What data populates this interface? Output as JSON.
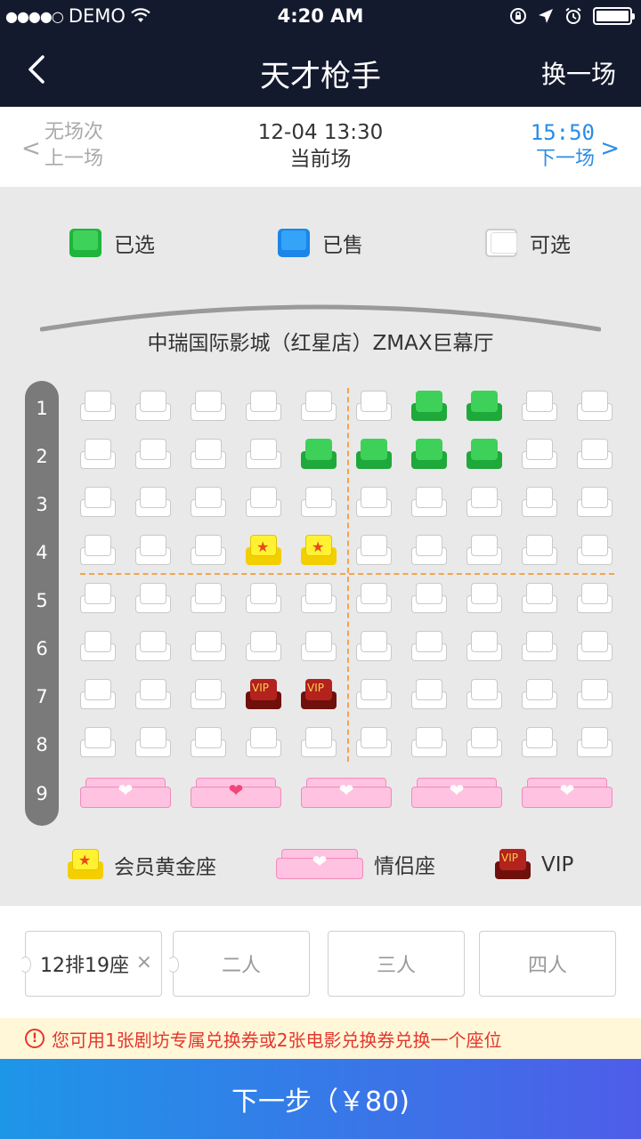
{
  "status": {
    "carrier": "DEMO",
    "time": "4:20 AM"
  },
  "nav": {
    "back_icon": "chevron-left-icon",
    "title": "天才枪手",
    "switch_label": "换一场"
  },
  "session": {
    "prev_line1": "无场次",
    "prev_line2": "上一场",
    "current_time": "12-04 13:30",
    "current_label": "当前场",
    "next_time": "15:50",
    "next_label": "下一场"
  },
  "legend": {
    "selected": "已选",
    "sold": "已售",
    "available": "可选"
  },
  "hall": {
    "name": "中瑞国际影城（红星店）ZMAX巨幕厅"
  },
  "rows": [
    "1",
    "2",
    "3",
    "4",
    "5",
    "6",
    "7",
    "8",
    "9"
  ],
  "seats": [
    [
      "white",
      "white",
      "white",
      "white",
      "white",
      "white",
      "green",
      "green",
      "white",
      "white"
    ],
    [
      "white",
      "white",
      "white",
      "white",
      "green",
      "green",
      "green",
      "green",
      "white",
      "white"
    ],
    [
      "white",
      "white",
      "white",
      "white",
      "white",
      "white",
      "white",
      "white",
      "white",
      "white"
    ],
    [
      "white",
      "white",
      "white",
      "gold",
      "gold",
      "white",
      "white",
      "white",
      "white",
      "white"
    ],
    [
      "white",
      "white",
      "white",
      "white",
      "white",
      "white",
      "white",
      "white",
      "white",
      "white"
    ],
    [
      "white",
      "white",
      "white",
      "white",
      "white",
      "white",
      "white",
      "white",
      "white",
      "white"
    ],
    [
      "white",
      "white",
      "white",
      "vip",
      "vip",
      "white",
      "white",
      "white",
      "white",
      "white"
    ],
    [
      "white",
      "white",
      "white",
      "white",
      "white",
      "white",
      "white",
      "white",
      "white",
      "white"
    ]
  ],
  "love_seats": [
    "normal",
    "selected",
    "normal",
    "normal",
    "normal"
  ],
  "vip_text": "VIP",
  "legend_bottom": {
    "gold": "会员黄金座",
    "couple": "情侣座",
    "vip": "VIP"
  },
  "picker": {
    "selected_seat": "12排19座",
    "slot2": "二人",
    "slot3": "三人",
    "slot4": "四人"
  },
  "notice": "您可用1张剧坊专属兑换券或2张电影兑换券兑换一个座位",
  "next_button": "下一步（￥80)",
  "colors": {
    "accent_blue": "#2a8de6",
    "selected_green": "#3ed15a",
    "sold_blue": "#33a4f7",
    "couple_pink": "#ffc2e0",
    "vip_red": "#b3221c",
    "gold": "#fff233"
  }
}
